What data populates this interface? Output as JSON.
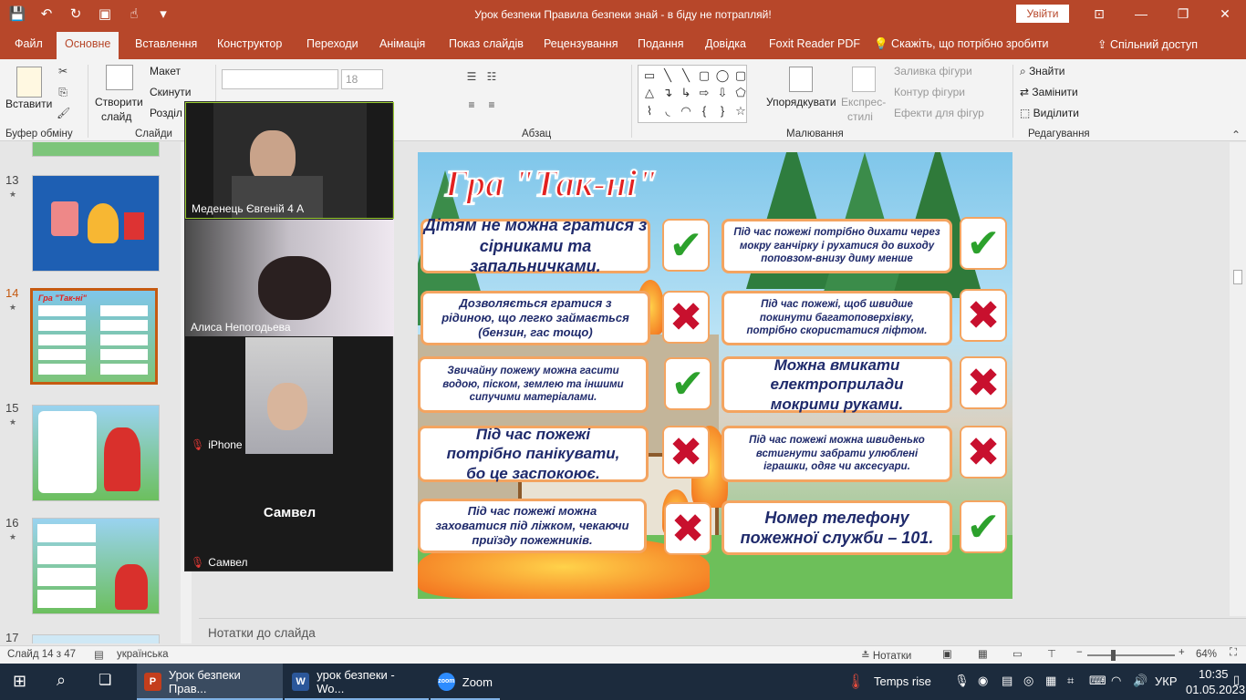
{
  "window": {
    "title": "Урок безпеки Правила безпеки знай - в біду не потрапляй!",
    "signin": "Увійти"
  },
  "tabs": [
    "Файл",
    "Основне",
    "Вставлення",
    "Конструктор",
    "Переходи",
    "Анімація",
    "Показ слайдів",
    "Рецензування",
    "Подання",
    "Довідка",
    "Foxit Reader PDF"
  ],
  "tell_me": "Скажіть, що потрібно зробити",
  "share": "Спільний доступ",
  "ribbon": {
    "paste": "Вставити",
    "clipboard_group": "Буфер обміну",
    "new_slide_1": "Створити",
    "new_slide_2": "слайд",
    "layout": "Макет",
    "reset": "Скинути",
    "section": "Розділ",
    "slides_group": "Слайди",
    "font_size": "18",
    "paragraph_group": "Абзац",
    "arrange": "Упорядкувати",
    "quick_styles_1": "Експрес-",
    "quick_styles_2": "стилі",
    "shape_fill": "Заливка фігури",
    "shape_outline": "Контур фігури",
    "shape_effects": "Ефекти для фігур",
    "drawing_group": "Малювання",
    "find": "Знайти",
    "replace": "Замінити",
    "select": "Виділити",
    "editing_group": "Редагування"
  },
  "thumbnails": [
    {
      "num": "13",
      "star": "★"
    },
    {
      "num": "14",
      "star": "★"
    },
    {
      "num": "15",
      "star": "★"
    },
    {
      "num": "16",
      "star": "★"
    },
    {
      "num": "17",
      "star": ""
    }
  ],
  "slide": {
    "title": "Гра \"Так-ні\"",
    "rows": [
      {
        "left": "Дітям не  можна гратися з сірниками та запальничками.",
        "left_ans": "yes",
        "right": "Під час пожежі потрібно дихати через мокру ганчірку і рухатися до виходу поповзом-внизу диму менше",
        "right_ans": "yes"
      },
      {
        "left": "Дозволяється гратися з рідиною, що легко займається (бензин, гас тощо)",
        "left_ans": "no",
        "right": "Під час пожежі, щоб швидше покинути багатоповерхівку, потрібно скористатися ліфтом.",
        "right_ans": "no"
      },
      {
        "left": "Звичайну пожежу можна гасити водою, піском, землею та іншими сипучими матеріалами.",
        "left_ans": "yes",
        "right": "Можна вмикати електроприлади мокрими руками.",
        "right_ans": "no"
      },
      {
        "left": "Під час пожежі потрібно панікувати, бо це заспокоює.",
        "left_ans": "no",
        "right": "Під час пожежі можна швиденько встигнути забрати улюблені іграшки, одяг чи аксесуари.",
        "right_ans": "no"
      },
      {
        "left": "Під час пожежі можна заховатися під ліжком, чекаючи приїзду пожежників.",
        "left_ans": "no",
        "right": "Номер телефону пожежної служби – 101.",
        "right_ans": "yes"
      }
    ]
  },
  "zoom": {
    "participants": [
      {
        "name": "Меденець Євгеній 4 А",
        "muted": false
      },
      {
        "name": "Алиса Непогодьева",
        "muted": false
      },
      {
        "name": "iPhone",
        "muted": true
      },
      {
        "name": "Самвел",
        "muted": true,
        "center_name": "Самвел"
      }
    ]
  },
  "notes_placeholder": "Нотатки до слайда",
  "status": {
    "slide_info": "Слайд 14 з 47",
    "language": "українська",
    "notes_btn": "Нотатки",
    "zoom": "64%"
  },
  "taskbar": {
    "apps": [
      {
        "label": "Урок безпеки Прав...",
        "icon": "P",
        "color": "#c43e1c"
      },
      {
        "label": "урок безпеки - Wo...",
        "icon": "W",
        "color": "#2b579a"
      },
      {
        "label": "Zoom",
        "icon": "zoom",
        "color": "#2d8cff"
      }
    ],
    "weather": "Temps rise",
    "lang": "УКР",
    "time": "10:35",
    "date": "01.05.2023"
  }
}
